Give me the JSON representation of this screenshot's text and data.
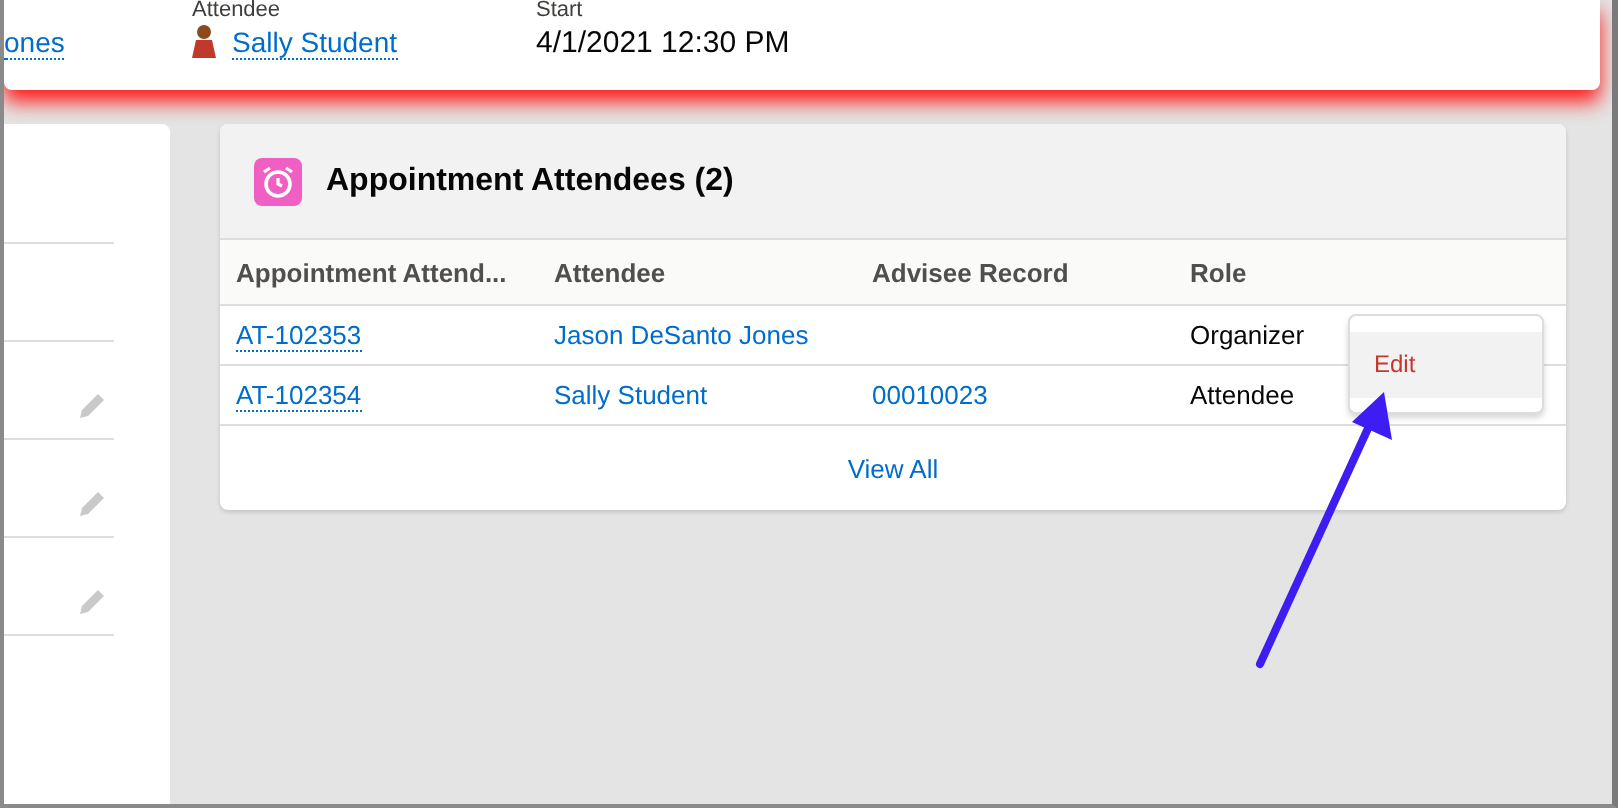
{
  "record_header": {
    "fields": [
      {
        "value": "ones",
        "kind": "link"
      },
      {
        "label": "Attendee",
        "value": "Sally Student",
        "kind": "user"
      },
      {
        "label": "Start",
        "value": "4/1/2021 12:30 PM",
        "kind": "text"
      }
    ]
  },
  "related_list": {
    "title": "Appointment Attendees (2)",
    "columns": [
      "Appointment Attend...",
      "Attendee",
      "Advisee Record",
      "Role"
    ],
    "rows": [
      {
        "cells": [
          "AT-102353",
          "Jason DeSanto Jones",
          "",
          "Organizer"
        ]
      },
      {
        "cells": [
          "AT-102354",
          "Sally Student",
          "00010023",
          "Attendee"
        ]
      }
    ],
    "view_all": "View All"
  },
  "row_menu": {
    "items": [
      "Edit"
    ]
  }
}
